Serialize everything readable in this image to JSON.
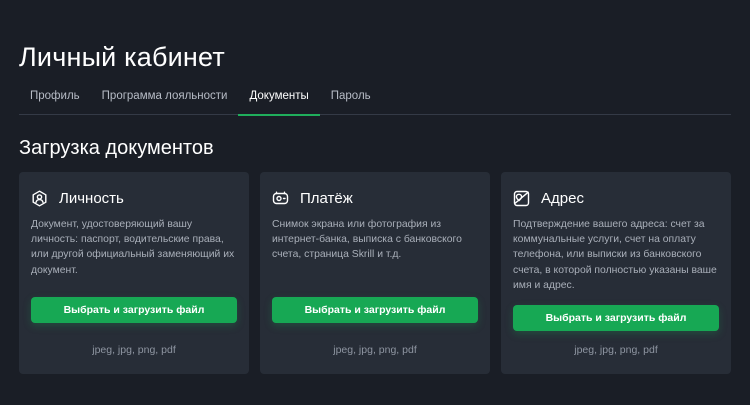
{
  "header": {
    "title": "Личный кабинет"
  },
  "tabs": [
    {
      "label": "Профиль",
      "active": false
    },
    {
      "label": "Программа лояльности",
      "active": false
    },
    {
      "label": "Документы",
      "active": true
    },
    {
      "label": "Пароль",
      "active": false
    }
  ],
  "section": {
    "title": "Загрузка документов"
  },
  "cards": [
    {
      "icon": "identity-icon",
      "title": "Личность",
      "description": "Документ, удостоверяющий вашу личность: паспорт, водительские права, или другой официальный заменяющий их документ.",
      "button": "Выбрать и загрузить файл",
      "formats": "jpeg, jpg, png, pdf"
    },
    {
      "icon": "payment-icon",
      "title": "Платёж",
      "description": "Снимок экрана или фотография из интернет-банка, выписка с банковского счета, страница Skrill и т.д.",
      "button": "Выбрать и загрузить файл",
      "formats": "jpeg, jpg, png, pdf"
    },
    {
      "icon": "address-icon",
      "title": "Адрес",
      "description": "Подтверждение вашего адреса: счет за коммунальные услуги, счет на оплату телефона, или выписки из банковского счета, в которой полностью указаны ваше имя и адрес.",
      "button": "Выбрать и загрузить файл",
      "formats": "jpeg, jpg, png, pdf"
    }
  ],
  "colors": {
    "background": "#1a1e26",
    "card": "#272d37",
    "accent": "#17a854",
    "tab_underline": "#1fae5b"
  }
}
